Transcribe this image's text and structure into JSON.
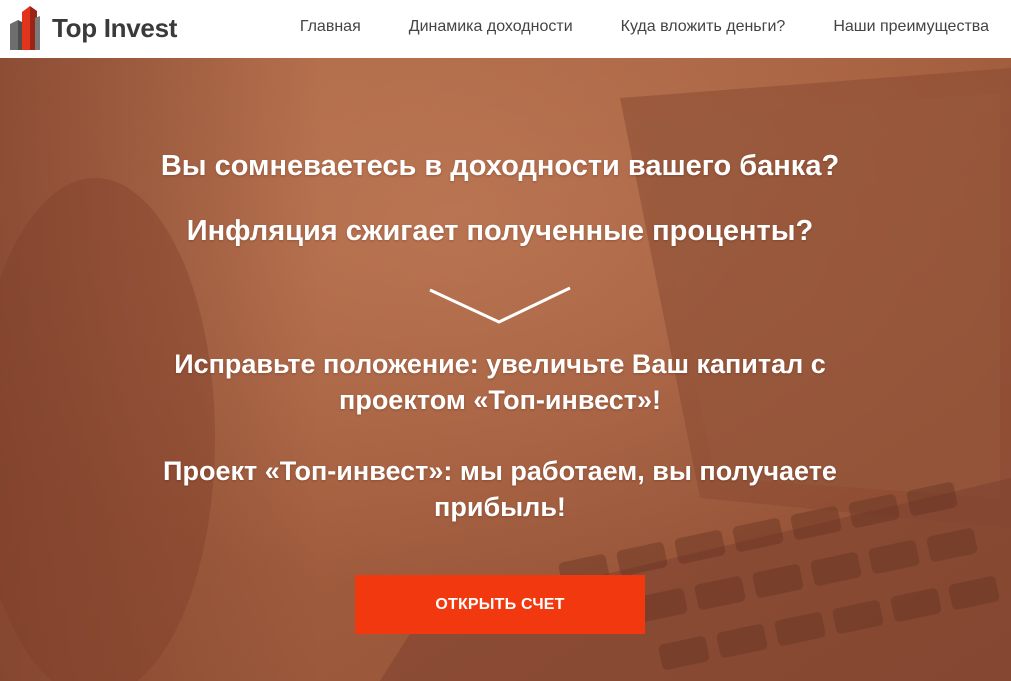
{
  "brand": {
    "name": "Top Invest",
    "logo_icon": "building-bars-icon",
    "colors": {
      "red": "#e0341c",
      "dark_red": "#9b2414",
      "gray": "#6e6e6e",
      "text": "#3a3a3a"
    }
  },
  "nav": {
    "items": [
      {
        "label": "Главная"
      },
      {
        "label": "Динамика доходности"
      },
      {
        "label": "Куда вложить деньги?"
      },
      {
        "label": "Наши преимущества"
      }
    ]
  },
  "hero": {
    "question_1": "Вы сомневаетесь в доходности вашего банка?",
    "question_2": "Инфляция сжигает полученные проценты?",
    "divider_icon": "chevron-down-icon",
    "pitch_1": "Исправьте положение: увеличьте Ваш капитал с проектом «Топ-инвест»!",
    "pitch_2": "Проект «Топ-инвест»: мы работаем, вы получаете прибыль!",
    "cta_label": "ОТКРЫТЬ СЧЕТ",
    "background": "laptop-photo-with-orange-overlay",
    "colors": {
      "overlay": "#a65e3e",
      "cta": "#f2380e",
      "text": "#ffffff"
    }
  }
}
